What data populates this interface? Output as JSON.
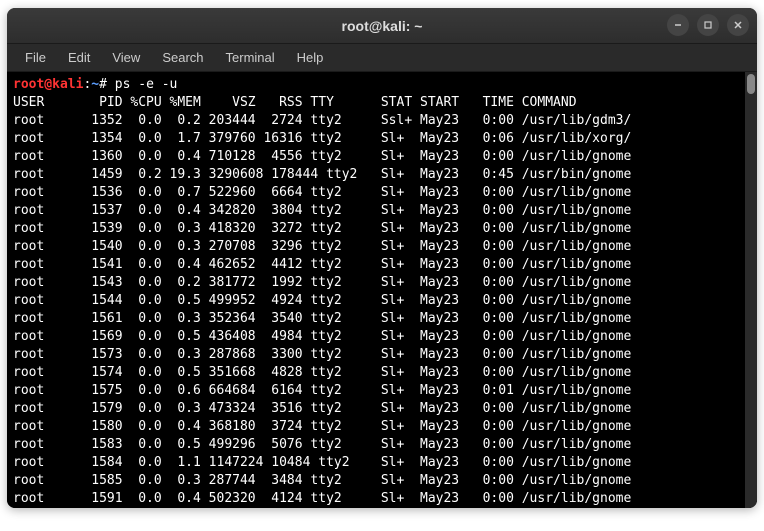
{
  "window": {
    "title": "root@kali: ~"
  },
  "menu": {
    "file": "File",
    "edit": "Edit",
    "view": "View",
    "search": "Search",
    "terminal": "Terminal",
    "help": "Help"
  },
  "prompt": {
    "user": "root@kali",
    "sep1": ":",
    "path": "~",
    "sep2": "# ",
    "command": "ps -e -u"
  },
  "ps": {
    "header": "USER       PID %CPU %MEM    VSZ   RSS TTY      STAT START   TIME COMMAND",
    "rows": [
      "root      1352  0.0  0.2 203444  2724 tty2     Ssl+ May23   0:00 /usr/lib/gdm3/",
      "root      1354  0.0  1.7 379760 16316 tty2     Sl+  May23   0:06 /usr/lib/xorg/",
      "root      1360  0.0  0.4 710128  4556 tty2     Sl+  May23   0:00 /usr/lib/gnome",
      "root      1459  0.2 19.3 3290608 178444 tty2   Sl+  May23   0:45 /usr/bin/gnome",
      "root      1536  0.0  0.7 522960  6664 tty2     Sl+  May23   0:00 /usr/lib/gnome",
      "root      1537  0.0  0.4 342820  3804 tty2     Sl+  May23   0:00 /usr/lib/gnome",
      "root      1539  0.0  0.3 418320  3272 tty2     Sl+  May23   0:00 /usr/lib/gnome",
      "root      1540  0.0  0.3 270708  3296 tty2     Sl+  May23   0:00 /usr/lib/gnome",
      "root      1541  0.0  0.4 462652  4412 tty2     Sl+  May23   0:00 /usr/lib/gnome",
      "root      1543  0.0  0.2 381772  1992 tty2     Sl+  May23   0:00 /usr/lib/gnome",
      "root      1544  0.0  0.5 499952  4924 tty2     Sl+  May23   0:00 /usr/lib/gnome",
      "root      1561  0.0  0.3 352364  3540 tty2     Sl+  May23   0:00 /usr/lib/gnome",
      "root      1569  0.0  0.5 436408  4984 tty2     Sl+  May23   0:00 /usr/lib/gnome",
      "root      1573  0.0  0.3 287868  3300 tty2     Sl+  May23   0:00 /usr/lib/gnome",
      "root      1574  0.0  0.5 351668  4828 tty2     Sl+  May23   0:00 /usr/lib/gnome",
      "root      1575  0.0  0.6 664684  6164 tty2     Sl+  May23   0:01 /usr/lib/gnome",
      "root      1579  0.0  0.3 473324  3516 tty2     Sl+  May23   0:00 /usr/lib/gnome",
      "root      1580  0.0  0.4 368180  3724 tty2     Sl+  May23   0:00 /usr/lib/gnome",
      "root      1583  0.0  0.5 499296  5076 tty2     Sl+  May23   0:00 /usr/lib/gnome",
      "root      1584  0.0  1.1 1147224 10484 tty2    Sl+  May23   0:00 /usr/lib/gnome",
      "root      1585  0.0  0.3 287744  3484 tty2     Sl+  May23   0:00 /usr/lib/gnome",
      "root      1591  0.0  0.4 502320  4124 tty2     Sl+  May23   0:00 /usr/lib/gnome"
    ]
  }
}
